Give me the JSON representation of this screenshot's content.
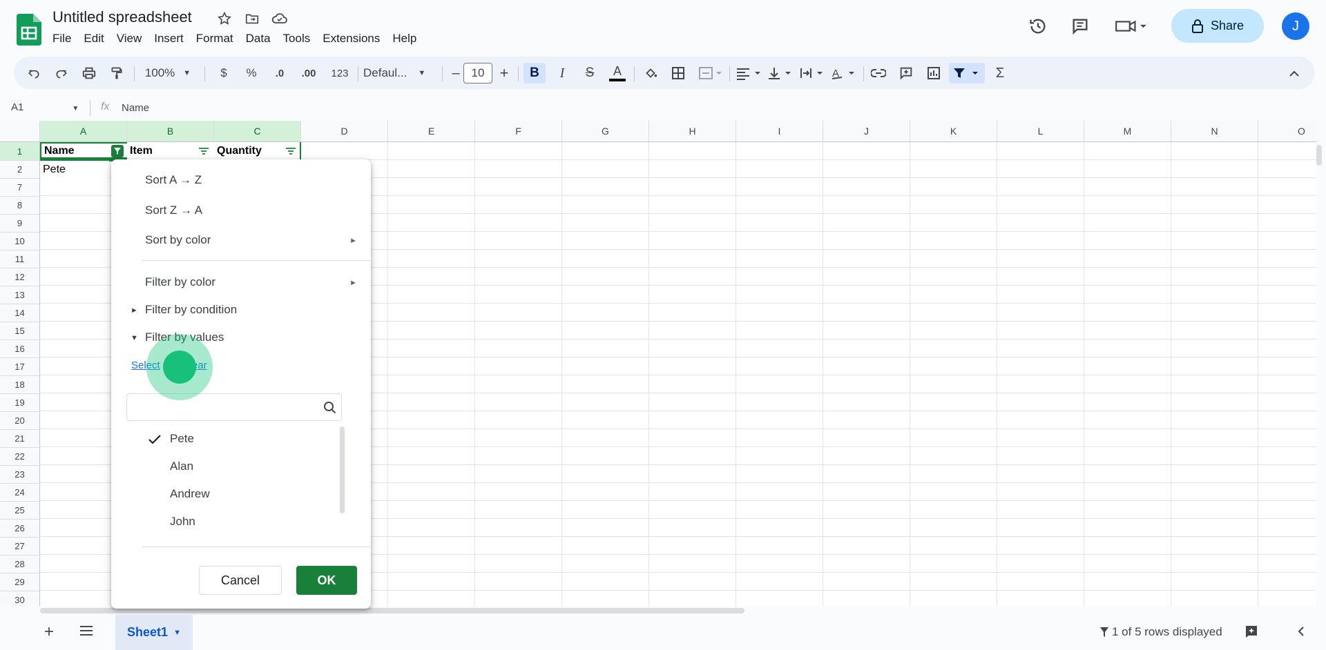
{
  "app": {
    "title": "Untitled spreadsheet",
    "menu": [
      "File",
      "Edit",
      "View",
      "Insert",
      "Format",
      "Data",
      "Tools",
      "Extensions",
      "Help"
    ],
    "share_label": "Share",
    "avatar_letter": "J"
  },
  "toolbar": {
    "zoom": "100%",
    "currency": "$",
    "percent": "%",
    "dec_decrease": ".0",
    "dec_increase": ".00",
    "number_format": "123",
    "font": "Defaul...",
    "font_size": "10",
    "minus": "–",
    "plus": "+"
  },
  "formula_bar": {
    "cell_ref": "A1",
    "fx": "fx",
    "content": "Name"
  },
  "grid": {
    "columns": [
      "A",
      "B",
      "C",
      "D",
      "E",
      "F",
      "G",
      "H",
      "I",
      "J",
      "K",
      "L",
      "M",
      "N",
      "O"
    ],
    "rows": [
      "1",
      "2",
      "7",
      "8",
      "9",
      "10",
      "11",
      "12",
      "13",
      "14",
      "15",
      "16",
      "17",
      "18",
      "19",
      "20",
      "21",
      "22",
      "23",
      "24",
      "25",
      "26",
      "27",
      "28",
      "29",
      "30"
    ],
    "cells": {
      "A1": "Name",
      "B1": "Item",
      "C1": "Quantity",
      "A2": "Pete"
    }
  },
  "filter_menu": {
    "sort_az": "Sort A → Z",
    "sort_za": "Sort Z → A",
    "sort_by_color": "Sort by color",
    "filter_by_color": "Filter by color",
    "filter_by_condition": "Filter by condition",
    "filter_by_values": "Filter by values",
    "select_all": "Select",
    "clear": "ear",
    "values": [
      {
        "label": "Pete",
        "checked": true
      },
      {
        "label": "Alan",
        "checked": false
      },
      {
        "label": "Andrew",
        "checked": false
      },
      {
        "label": "John",
        "checked": false
      }
    ],
    "cancel": "Cancel",
    "ok": "OK"
  },
  "bottom": {
    "sheet_name": "Sheet1",
    "status": "1 of 5 rows displayed"
  },
  "colors": {
    "accent": "#1a73e8",
    "ok_green": "#188038",
    "selection_green": "#d3f0d9",
    "share_bg": "#c2e7ff"
  }
}
